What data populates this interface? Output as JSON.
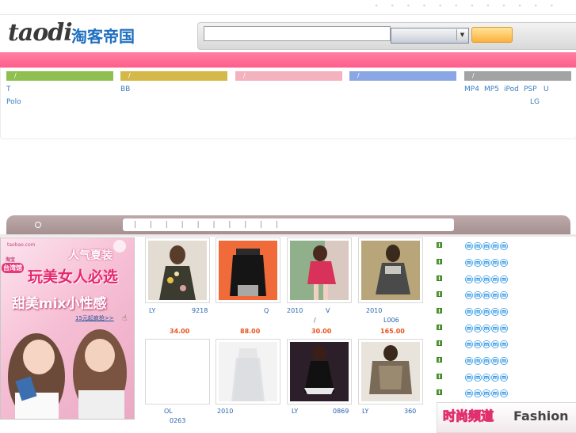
{
  "topbar": {
    "dots": "- - - - - - - - - - - -"
  },
  "header": {
    "logo_en": "taodi",
    "logo_cn": "淘客帝国"
  },
  "search": {
    "placeholder": "",
    "select_value": "",
    "button_label": ""
  },
  "categories": [
    {
      "bar_label": "/",
      "color": "#8dc050",
      "links": [
        "T",
        "Polo"
      ]
    },
    {
      "bar_label": "/",
      "color": "#d4b84a",
      "links": [
        "BB"
      ]
    },
    {
      "bar_label": "/",
      "color": "#f4b2bf",
      "links": []
    },
    {
      "bar_label": "/",
      "color": "#8aa6e4",
      "links": []
    },
    {
      "bar_label": "/",
      "color": "#a3a3a3",
      "links": [
        "MP4",
        "MP5",
        "iPod",
        "PSP",
        "U",
        "LG"
      ]
    }
  ],
  "nav": {
    "items": "| | | | | | | | | |"
  },
  "left_ad": {
    "site": "taobao.com",
    "badge_top": "淘宝",
    "badge": "台湾馆",
    "line1": "人气夏装",
    "line2": "玩美女人必选",
    "line3": "甜美mix小性感",
    "cta": "15元起疯抢>>"
  },
  "products": [
    {
      "caption_left": "LY",
      "caption_right": "9218",
      "price": "34.00"
    },
    {
      "caption_left": "",
      "caption_right": "Q",
      "price": "88.00"
    },
    {
      "caption_left": "2010",
      "caption_right": "V",
      "caption_sub": "/",
      "price": "30.00"
    },
    {
      "caption_left": "2010",
      "caption_right": "",
      "caption_sub": "L006",
      "price": "165.00"
    },
    {
      "caption_left": "OL",
      "caption_right": "",
      "caption_sub": "0263",
      "price": ""
    },
    {
      "caption_left": "2010",
      "caption_right": "",
      "price": ""
    },
    {
      "caption_left": "LY",
      "caption_right": "0869",
      "price": ""
    },
    {
      "caption_left": "LY",
      "caption_right": "360",
      "price": ""
    }
  ],
  "right_list": {
    "faces": "ⓜⓜⓜⓜⓜ",
    "count": 10
  },
  "fashion_box": {
    "cn": "时尚频道",
    "en": "Fashion"
  },
  "colors": {
    "accent_pink": "#ff6a93",
    "link_blue": "#3a7cc0",
    "price_orange": "#e8541c"
  }
}
